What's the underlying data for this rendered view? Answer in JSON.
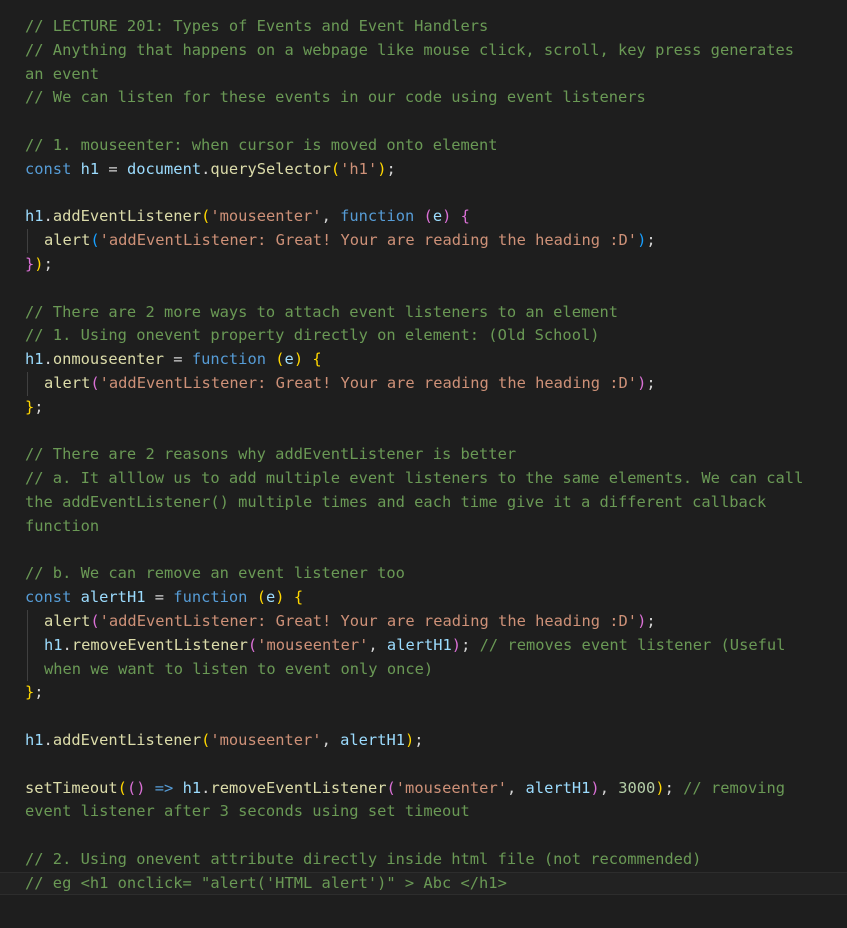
{
  "lines": [
    [
      [
        "c",
        "// LECTURE 201: Types of Events and Event Handlers"
      ]
    ],
    [
      [
        "c",
        "// Anything that happens on a webpage like mouse click, scroll, key press generates"
      ]
    ],
    [
      [
        "c",
        "an event"
      ]
    ],
    [
      [
        "c",
        "// We can listen for these events in our code using event listeners"
      ]
    ],
    [],
    [
      [
        "c",
        "// 1. mouseenter: when cursor is moved onto element"
      ]
    ],
    [
      [
        "k",
        "const "
      ],
      [
        "v",
        "h1"
      ],
      [
        "p",
        " = "
      ],
      [
        "v",
        "document"
      ],
      [
        "p",
        "."
      ],
      [
        "f",
        "querySelector"
      ],
      [
        "b1",
        "("
      ],
      [
        "s",
        "'h1'"
      ],
      [
        "b1",
        ")"
      ],
      [
        "p",
        ";"
      ]
    ],
    [],
    [
      [
        "v",
        "h1"
      ],
      [
        "p",
        "."
      ],
      [
        "f",
        "addEventListener"
      ],
      [
        "b1",
        "("
      ],
      [
        "s",
        "'mouseenter'"
      ],
      [
        "p",
        ", "
      ],
      [
        "k",
        "function"
      ],
      [
        "p",
        " "
      ],
      [
        "b2",
        "("
      ],
      [
        "v",
        "e"
      ],
      [
        "b2",
        ")"
      ],
      [
        "p",
        " "
      ],
      [
        "b2",
        "{"
      ]
    ],
    {
      "indent": true,
      "t": [
        [
          "f",
          "alert"
        ],
        [
          "b3",
          "("
        ],
        [
          "s",
          "'addEventListener: Great! Your are reading the heading :D'"
        ],
        [
          "b3",
          ")"
        ],
        [
          "p",
          ";"
        ]
      ]
    },
    [
      [
        "b2",
        "}"
      ],
      [
        "b1",
        ")"
      ],
      [
        "p",
        ";"
      ]
    ],
    [],
    [
      [
        "c",
        "// There are 2 more ways to attach event listeners to an element"
      ]
    ],
    [
      [
        "c",
        "// 1. Using onevent property directly on element: (Old School)"
      ]
    ],
    [
      [
        "v",
        "h1"
      ],
      [
        "p",
        "."
      ],
      [
        "f",
        "onmouseenter"
      ],
      [
        "p",
        " = "
      ],
      [
        "k",
        "function"
      ],
      [
        "p",
        " "
      ],
      [
        "b1",
        "("
      ],
      [
        "v",
        "e"
      ],
      [
        "b1",
        ")"
      ],
      [
        "p",
        " "
      ],
      [
        "b1",
        "{"
      ]
    ],
    {
      "indent": true,
      "t": [
        [
          "f",
          "alert"
        ],
        [
          "b2",
          "("
        ],
        [
          "s",
          "'addEventListener: Great! Your are reading the heading :D'"
        ],
        [
          "b2",
          ")"
        ],
        [
          "p",
          ";"
        ]
      ]
    },
    [
      [
        "b1",
        "}"
      ],
      [
        "p",
        ";"
      ]
    ],
    [],
    [
      [
        "c",
        "// There are 2 reasons why addEventListener is better"
      ]
    ],
    [
      [
        "c",
        "// a. It alllow us to add multiple event listeners to the same elements. We can call"
      ]
    ],
    [
      [
        "c",
        "the addEventListener() multiple times and each time give it a different callback"
      ]
    ],
    [
      [
        "c",
        "function"
      ]
    ],
    [],
    [
      [
        "c",
        "// b. We can remove an event listener too"
      ]
    ],
    [
      [
        "k",
        "const "
      ],
      [
        "v",
        "alertH1"
      ],
      [
        "p",
        " = "
      ],
      [
        "k",
        "function"
      ],
      [
        "p",
        " "
      ],
      [
        "b1",
        "("
      ],
      [
        "v",
        "e"
      ],
      [
        "b1",
        ")"
      ],
      [
        "p",
        " "
      ],
      [
        "b1",
        "{"
      ]
    ],
    {
      "indent": true,
      "t": [
        [
          "f",
          "alert"
        ],
        [
          "b2",
          "("
        ],
        [
          "s",
          "'addEventListener: Great! Your are reading the heading :D'"
        ],
        [
          "b2",
          ")"
        ],
        [
          "p",
          ";"
        ]
      ]
    },
    {
      "indent": true,
      "t": [
        [
          "v",
          "h1"
        ],
        [
          "p",
          "."
        ],
        [
          "f",
          "removeEventListener"
        ],
        [
          "b2",
          "("
        ],
        [
          "s",
          "'mouseenter'"
        ],
        [
          "p",
          ", "
        ],
        [
          "v",
          "alertH1"
        ],
        [
          "b2",
          ")"
        ],
        [
          "p",
          "; "
        ],
        [
          "c",
          "// removes event listener (Useful"
        ]
      ]
    },
    {
      "indent": true,
      "t": [
        [
          "c",
          "when we want to listen to event only once)"
        ]
      ]
    },
    [
      [
        "b1",
        "}"
      ],
      [
        "p",
        ";"
      ]
    ],
    [],
    [
      [
        "v",
        "h1"
      ],
      [
        "p",
        "."
      ],
      [
        "f",
        "addEventListener"
      ],
      [
        "b1",
        "("
      ],
      [
        "s",
        "'mouseenter'"
      ],
      [
        "p",
        ", "
      ],
      [
        "v",
        "alertH1"
      ],
      [
        "b1",
        ")"
      ],
      [
        "p",
        ";"
      ]
    ],
    [],
    [
      [
        "f",
        "setTimeout"
      ],
      [
        "b1",
        "("
      ],
      [
        "b2",
        "()"
      ],
      [
        "p",
        " "
      ],
      [
        "k",
        "=>"
      ],
      [
        "p",
        " "
      ],
      [
        "v",
        "h1"
      ],
      [
        "p",
        "."
      ],
      [
        "f",
        "removeEventListener"
      ],
      [
        "b2",
        "("
      ],
      [
        "s",
        "'mouseenter'"
      ],
      [
        "p",
        ", "
      ],
      [
        "v",
        "alertH1"
      ],
      [
        "b2",
        ")"
      ],
      [
        "p",
        ", "
      ],
      [
        "n",
        "3000"
      ],
      [
        "b1",
        ")"
      ],
      [
        "p",
        "; "
      ],
      [
        "c",
        "// removing"
      ]
    ],
    [
      [
        "c",
        "event listener after 3 seconds using set timeout"
      ]
    ],
    [],
    [
      [
        "c",
        "// 2. Using onevent attribute directly inside html file (not recommended)"
      ]
    ],
    {
      "current": true,
      "t": [
        [
          "c",
          "// eg <h1 onclick= \"alert('HTML alert')\" > Abc </h1>"
        ]
      ]
    }
  ]
}
